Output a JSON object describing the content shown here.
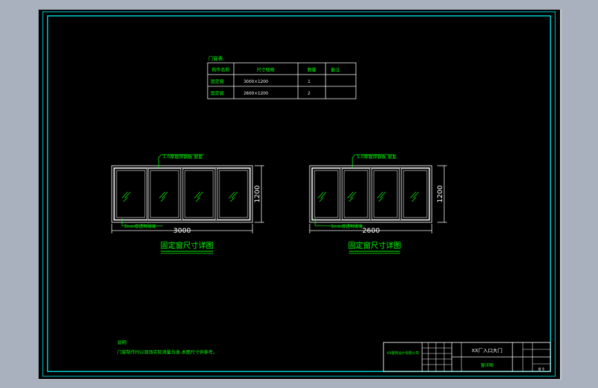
{
  "colors": {
    "frame": "#00d8e0",
    "line": "#ffffff",
    "text_green": "#00ff00",
    "glass_hatch": "#00ff00",
    "background": "#000000"
  },
  "schedule": {
    "title": "门窗表:",
    "headers": [
      "构件名称",
      "尺寸规格",
      "数量",
      "备注"
    ],
    "rows": [
      [
        "固定窗",
        "3000×1200",
        "1",
        ""
      ],
      [
        "固定窗",
        "2600×1200",
        "2",
        ""
      ]
    ]
  },
  "window_a": {
    "leader_top": "1.0厚镀锌钢板 窗套",
    "leader_bottom": "5mm厚透明玻璃",
    "width_dim": "3000",
    "height_dim": "1200",
    "caption": "固定窗尺寸详图"
  },
  "window_b": {
    "leader_top": "1.0厚镀锌钢板 窗套",
    "leader_bottom": "5mm厚透明玻璃",
    "width_dim": "2600",
    "height_dim": "1200",
    "caption": "固定窗尺寸详图"
  },
  "notes": {
    "heading": "说明:",
    "line1": "门窗制作时以现场实际测量为准,本图尺寸供参考。"
  },
  "title_block": {
    "company": "XX建筑设计有限公司",
    "project": "XX厂入口大门",
    "drawing": "窗详图",
    "sheet": "图 号"
  }
}
